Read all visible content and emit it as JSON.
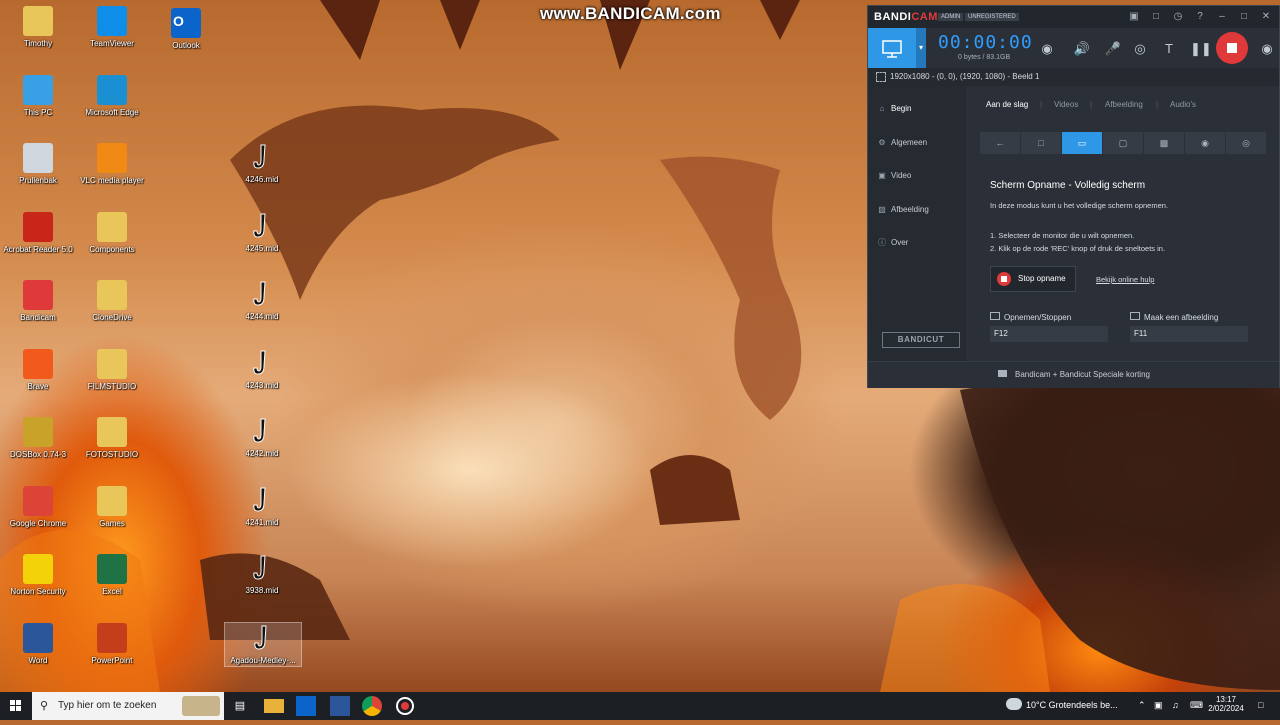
{
  "watermark": "www.BANDICAM.com",
  "desktop": {
    "icons_col1": [
      {
        "label": "Timothy",
        "icon": "user-folder-icon"
      },
      {
        "label": "This PC",
        "icon": "computer-icon"
      },
      {
        "label": "Prullenbak",
        "icon": "recycle-bin-icon"
      },
      {
        "label": "Acrobat Reader 5.0",
        "icon": "acrobat-icon"
      },
      {
        "label": "Bandicam",
        "icon": "bandicam-icon"
      },
      {
        "label": "Brave",
        "icon": "brave-icon"
      },
      {
        "label": "DOSBox 0.74-3",
        "icon": "dosbox-icon"
      },
      {
        "label": "Google Chrome",
        "icon": "chrome-icon"
      },
      {
        "label": "Norton Security",
        "icon": "norton-icon"
      },
      {
        "label": "Word",
        "icon": "word-icon"
      }
    ],
    "icons_col2": [
      {
        "label": "TeamViewer",
        "icon": "teamviewer-icon"
      },
      {
        "label": "Microsoft Edge",
        "icon": "edge-icon"
      },
      {
        "label": "VLC media player",
        "icon": "vlc-icon"
      },
      {
        "label": "Components",
        "icon": "folder-icon"
      },
      {
        "label": "CloneDrive",
        "icon": "folder-icon"
      },
      {
        "label": "FILMSTUDIO",
        "icon": "folder-icon"
      },
      {
        "label": "FOTOSTUDIO",
        "icon": "folder-icon"
      },
      {
        "label": "Games",
        "icon": "folder-icon"
      },
      {
        "label": "Excel",
        "icon": "excel-icon"
      },
      {
        "label": "PowerPoint",
        "icon": "powerpoint-icon"
      }
    ],
    "outlook": {
      "label": "Outlook",
      "icon": "outlook-icon"
    },
    "midi_files": [
      "4246.mid",
      "4245.mid",
      "4244.mid",
      "4243.mid",
      "4242.mid",
      "4241.mid",
      "3938.mid",
      "Agadou-Medley-..."
    ]
  },
  "bandicam": {
    "brand_a": "BANDI",
    "brand_b": "CAM",
    "badge_admin": "ADMIN",
    "badge_unreg": "UNREGISTERED",
    "timer": "00:00:00",
    "size": "0 bytes / 83.1GB",
    "info_bar": "1920x1080 - (0, 0), (1920, 1080) - Beeld 1",
    "sidebar": [
      {
        "label": "Begin",
        "icon": "home-icon"
      },
      {
        "label": "Algemeen",
        "icon": "gear-icon"
      },
      {
        "label": "Video",
        "icon": "video-icon"
      },
      {
        "label": "Afbeelding",
        "icon": "image-icon"
      },
      {
        "label": "Over",
        "icon": "info-icon"
      }
    ],
    "bandicut": "BANDICUT",
    "tabs": [
      "Aan de slag",
      "Videos",
      "Afbeelding",
      "Audio's"
    ],
    "heading": "Scherm Opname - Volledig scherm",
    "desc": "In deze modus kunt u het volledige scherm opnemen.",
    "step1": "1. Selecteer de monitor die u wilt opnemen.",
    "step2": "2. Klik op de rode 'REC' knop of druk de sneltoets in.",
    "stop_label": "Stop opname",
    "help_link": "Bekijk online hulp",
    "hotkey1_label": "Opnemen/Stoppen",
    "hotkey1_value": "F12",
    "hotkey2_label": "Maak een afbeelding",
    "hotkey2_value": "F11",
    "footer": "Bandicam + Bandicut Speciale korting",
    "accent": "#2f98e6",
    "rec_color": "#e0393a"
  },
  "taskbar": {
    "search_placeholder": "Typ hier om te zoeken",
    "weather": "10°C  Grotendeels be...",
    "time": "13:17",
    "date": "2/02/2024"
  }
}
